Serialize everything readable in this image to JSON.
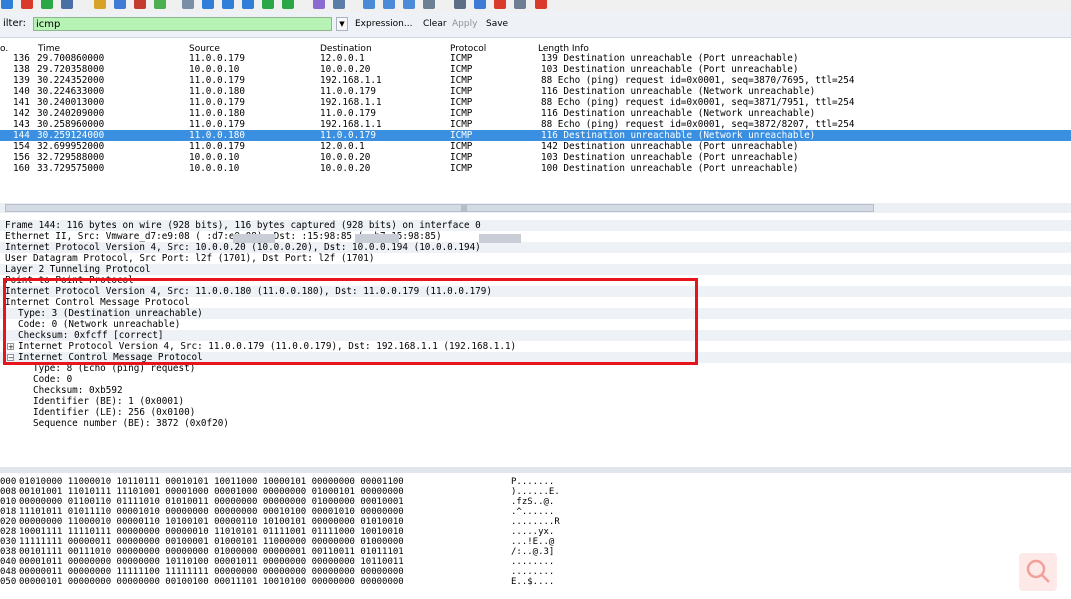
{
  "toolbar": {
    "icons": [
      "start-icon",
      "stop-icon",
      "restart-icon",
      "options-icon",
      "open-icon",
      "save-icon",
      "close-icon",
      "reload-icon",
      "find-icon",
      "back-icon",
      "forward-icon",
      "goto-icon",
      "top-icon",
      "bottom-icon",
      "colorize-icon",
      "autoscroll-icon",
      "zoom-in-icon",
      "zoom-out-icon",
      "normal-size-icon",
      "resize-columns-icon",
      "capture-filters-icon",
      "display-filters-icon",
      "coloring-rules-icon",
      "preferences-icon",
      "help-icon"
    ]
  },
  "filter": {
    "label": "ilter:",
    "value": "icmp",
    "expression": "Expression...",
    "clear": "Clear",
    "apply": "Apply",
    "save": "Save"
  },
  "columns": {
    "no": "o.",
    "time": "Time",
    "source": "Source",
    "destination": "Destination",
    "protocol": "Protocol",
    "length_info": "Length Info"
  },
  "packets": [
    {
      "no": "136",
      "time": "29.700860000",
      "source": "11.0.0.179",
      "destination": "12.0.0.1",
      "protocol": "ICMP",
      "info": "139 Destination unreachable (Port unreachable)"
    },
    {
      "no": "138",
      "time": "29.720358000",
      "source": "10.0.0.10",
      "destination": "10.0.0.20",
      "protocol": "ICMP",
      "info": "103 Destination unreachable (Port unreachable)"
    },
    {
      "no": "139",
      "time": "30.224352000",
      "source": "11.0.0.179",
      "destination": "192.168.1.1",
      "protocol": "ICMP",
      "info": " 88 Echo (ping) request  id=0x0001, seq=3870/7695, ttl=254"
    },
    {
      "no": "140",
      "time": "30.224633000",
      "source": "11.0.0.180",
      "destination": "11.0.0.179",
      "protocol": "ICMP",
      "info": "116 Destination unreachable (Network unreachable)"
    },
    {
      "no": "141",
      "time": "30.240013000",
      "source": "11.0.0.179",
      "destination": "192.168.1.1",
      "protocol": "ICMP",
      "info": " 88 Echo (ping) request  id=0x0001, seq=3871/7951, ttl=254"
    },
    {
      "no": "142",
      "time": "30.240209000",
      "source": "11.0.0.180",
      "destination": "11.0.0.179",
      "protocol": "ICMP",
      "info": "116 Destination unreachable (Network unreachable)"
    },
    {
      "no": "143",
      "time": "30.258960000",
      "source": "11.0.0.179",
      "destination": "192.168.1.1",
      "protocol": "ICMP",
      "info": " 88 Echo (ping) request  id=0x0001, seq=3872/8207, ttl=254"
    },
    {
      "no": "144",
      "time": "30.259124000",
      "source": "11.0.0.180",
      "destination": "11.0.0.179",
      "protocol": "ICMP",
      "info": "116 Destination unreachable (Network unreachable)",
      "selected": true
    },
    {
      "no": "154",
      "time": "32.699952000",
      "source": "11.0.0.179",
      "destination": "12.0.0.1",
      "protocol": "ICMP",
      "info": "142 Destination unreachable (Port unreachable)"
    },
    {
      "no": "156",
      "time": "32.729588000",
      "source": "10.0.0.10",
      "destination": "10.0.0.20",
      "protocol": "ICMP",
      "info": "103 Destination unreachable (Port unreachable)"
    },
    {
      "no": "160",
      "time": "33.729575000",
      "source": "10.0.0.10",
      "destination": "10.0.0.20",
      "protocol": "ICMP",
      "info": "100 Destination unreachable (Port unreachable)"
    }
  ],
  "details": [
    {
      "text": "Frame 144: 116 bytes on wire (928 bits), 116 bytes captured (928 bits) on interface 0",
      "indent": 0,
      "toggle": "",
      "shade": true
    },
    {
      "text": "Ethernet II, Src: Vmware_d7:e9:08 (     :d7:e9:08), Dst:        :15:98:85 (     .b7:15:98:85)",
      "indent": 0,
      "toggle": "",
      "shade": false
    },
    {
      "text": "Internet Protocol Version 4, Src: 10.0.0.20 (10.0.0.20), Dst: 10.0.0.194 (10.0.0.194)",
      "indent": 0,
      "toggle": "",
      "shade": true
    },
    {
      "text": "User Datagram Protocol, Src Port: l2f (1701), Dst Port: l2f (1701)",
      "indent": 0,
      "toggle": "",
      "shade": false
    },
    {
      "text": "Layer 2 Tunneling Protocol",
      "indent": 0,
      "toggle": "",
      "shade": true
    },
    {
      "text": "Point-to-Point Protocol",
      "indent": 0,
      "toggle": "",
      "shade": false
    },
    {
      "text": "Internet Protocol Version 4, Src: 11.0.0.180 (11.0.0.180), Dst: 11.0.0.179 (11.0.0.179)",
      "indent": 0,
      "toggle": "",
      "shade": true
    },
    {
      "text": "Internet Control Message Protocol",
      "indent": 0,
      "toggle": "",
      "shade": false
    },
    {
      "text": "Type: 3 (Destination unreachable)",
      "indent": 1,
      "toggle": "",
      "shade": true
    },
    {
      "text": "Code: 0 (Network unreachable)",
      "indent": 1,
      "toggle": "",
      "shade": false
    },
    {
      "text": "Checksum: 0xfcff [correct]",
      "indent": 1,
      "toggle": "",
      "shade": true
    },
    {
      "text": "Internet Protocol Version 4, Src: 11.0.0.179 (11.0.0.179), Dst: 192.168.1.1 (192.168.1.1)",
      "indent": 0,
      "toggle": "+",
      "shade": false
    },
    {
      "text": "Internet Control Message Protocol",
      "indent": 0,
      "toggle": "−",
      "shade": true
    },
    {
      "text": "Type: 8 (Echo (ping) request)",
      "indent": 2,
      "toggle": "",
      "shade": false
    },
    {
      "text": "Code: 0",
      "indent": 2,
      "toggle": "",
      "shade": false
    },
    {
      "text": "Checksum: 0xb592",
      "indent": 2,
      "toggle": "",
      "shade": false
    },
    {
      "text": "Identifier (BE): 1 (0x0001)",
      "indent": 2,
      "toggle": "",
      "shade": false
    },
    {
      "text": "Identifier (LE): 256 (0x0100)",
      "indent": 2,
      "toggle": "",
      "shade": false
    },
    {
      "text": "Sequence number (BE): 3872 (0x0f20)",
      "indent": 2,
      "toggle": "",
      "shade": false
    }
  ],
  "hex": [
    {
      "offset": "000",
      "bits": "01010000 11000010 10110111 00010101 10011000 10000101 00000000 00001100",
      "ascii": "P......."
    },
    {
      "offset": "008",
      "bits": "00101001 11010111 11101001 00001000 00001000 00000000 01000101 00000000",
      "ascii": ")......E."
    },
    {
      "offset": "010",
      "bits": "00000000 01100110 01111010 01010011 00000000 00000000 01000000 00010001",
      "ascii": ".fzS..@."
    },
    {
      "offset": "018",
      "bits": "11101011 01011110 00001010 00000000 00000000 00010100 00001010 00000000",
      "ascii": ".^......"
    },
    {
      "offset": "020",
      "bits": "00000000 11000010 00000110 10100101 00000110 10100101 00000000 01010010",
      "ascii": "........R"
    },
    {
      "offset": "028",
      "bits": "10001111 11110111 00000000 00000010 11010101 01111001 01111000 10010010",
      "ascii": ".....yx."
    },
    {
      "offset": "030",
      "bits": "11111111 00000011 00000000 00100001 01000101 11000000 00000000 01000000",
      "ascii": "...!E..@"
    },
    {
      "offset": "038",
      "bits": "00101111 00111010 00000000 00000000 01000000 00000001 00110011 01011101",
      "ascii": "/:..@.3]"
    },
    {
      "offset": "040",
      "bits": "00001011 00000000 00000000 10110100 00001011 00000000 00000000 10110011",
      "ascii": "........"
    },
    {
      "offset": "048",
      "bits": "00000011 00000000 11111100 11111111 00000000 00000000 00000000 00000000",
      "ascii": "........"
    },
    {
      "offset": "050",
      "bits": "00000101 00000000 00000000 00100100 00011101 10010100 00000000 00000000",
      "ascii": "E..$...."
    }
  ]
}
